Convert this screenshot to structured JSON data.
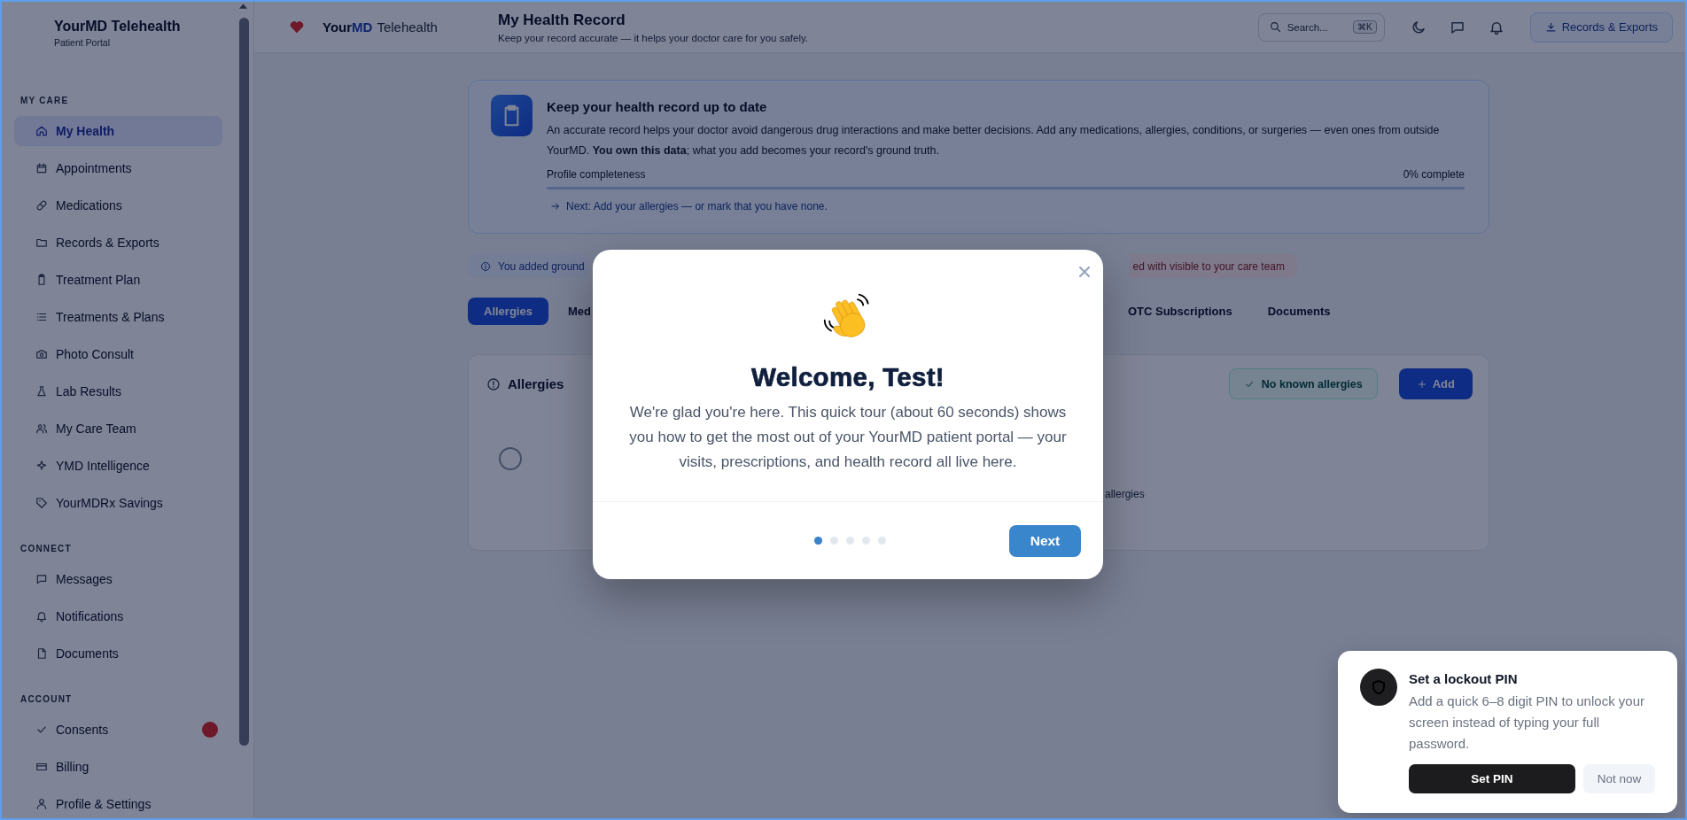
{
  "sidebar": {
    "brand": "YourMD Telehealth",
    "subtitle": "Patient Portal",
    "sections": [
      {
        "heading": "MY CARE",
        "items": [
          {
            "label": "My Health",
            "selected": true,
            "badge": false
          },
          {
            "label": "Appointments",
            "selected": false,
            "badge": false
          },
          {
            "label": "Medications",
            "selected": false,
            "badge": false
          },
          {
            "label": "Records & Exports",
            "selected": false,
            "badge": false
          },
          {
            "label": "Treatment Plan",
            "selected": false,
            "badge": false
          },
          {
            "label": "Treatments & Plans",
            "selected": false,
            "badge": false
          },
          {
            "label": "Photo Consult",
            "selected": false,
            "badge": false
          },
          {
            "label": "Lab Results",
            "selected": false,
            "badge": false
          },
          {
            "label": "My Care Team",
            "selected": false,
            "badge": false
          },
          {
            "label": "YMD Intelligence",
            "selected": false,
            "badge": false
          },
          {
            "label": "YourMDRx Savings",
            "selected": false,
            "badge": false
          }
        ]
      },
      {
        "heading": "CONNECT",
        "items": [
          {
            "label": "Messages",
            "selected": false,
            "badge": false
          },
          {
            "label": "Notifications",
            "selected": false,
            "badge": false
          },
          {
            "label": "Documents",
            "selected": false,
            "badge": false
          }
        ]
      },
      {
        "heading": "ACCOUNT",
        "items": [
          {
            "label": "Consents",
            "selected": false,
            "badge": true
          },
          {
            "label": "Billing",
            "selected": false,
            "badge": false
          },
          {
            "label": "Profile & Settings",
            "selected": false,
            "badge": false
          }
        ]
      }
    ]
  },
  "header": {
    "brand": {
      "name": "Your",
      "accent": "MD",
      "product": "Telehealth"
    },
    "title": "My Health Record",
    "subtitle": "Keep your record accurate — it helps your doctor care for you safely.",
    "search": {
      "placeholder": "Search...",
      "shortcut": "⌘K"
    },
    "action": "Records & Exports"
  },
  "banner": {
    "title": "Keep your health record up to date",
    "body": "An accurate record helps your doctor avoid dangerous drug interactions and make better decisions. Add any medications, allergies, conditions, or surgeries — even ones from outside YourMD. **You own this data**; what you add becomes your record's ground truth.",
    "progress": {
      "label": "Profile completeness",
      "reading": "0% complete",
      "level": 0
    },
    "next_step": "Next: Add your allergies — or mark that you have none."
  },
  "notices": [
    {
      "kind": "info",
      "text": "You added ground"
    },
    {
      "kind": "alert",
      "text": "ed with visible to your care team"
    }
  ],
  "tabs": [
    {
      "label": "Allergies",
      "selected": true
    },
    {
      "label": "Med",
      "selected": false
    },
    {
      "label": "OTC Subscriptions",
      "selected": false
    },
    {
      "label": "Documents",
      "selected": false
    }
  ],
  "allergies": {
    "title": "Allergies",
    "none_button": "No known allergies",
    "add_button": "Add",
    "empty_text": "allergies"
  },
  "modal": {
    "title": "Welcome, Test!",
    "body": "We're glad you're here. This quick tour (about 60 seconds) shows you how to get the most out of your YourMD patient portal — your visits, prescriptions, and health record all live here.",
    "steps": [
      {
        "selected": true
      },
      {
        "selected": false
      },
      {
        "selected": false
      },
      {
        "selected": false
      },
      {
        "selected": false
      }
    ],
    "next_button": "Next"
  },
  "toast": {
    "title": "Set a lockout PIN",
    "body": "Add a quick 6–8 digit PIN to unlock your screen instead of typing your full password.",
    "primary_button": "Set PIN",
    "secondary_button": "Not now"
  }
}
